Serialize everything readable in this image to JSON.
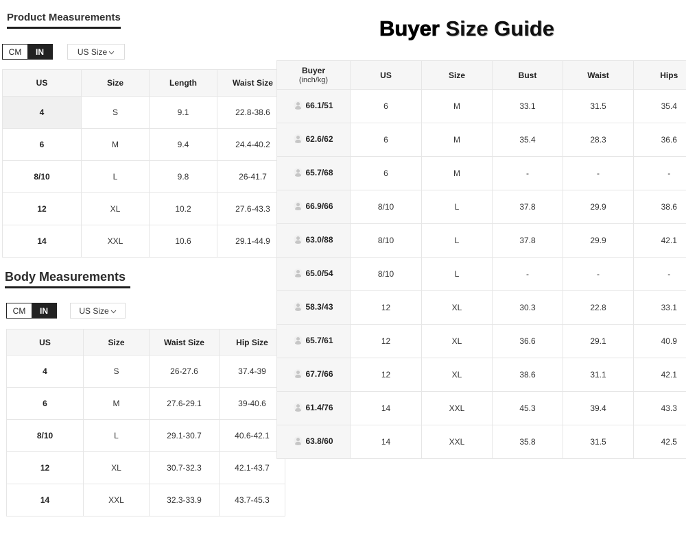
{
  "product_measurements": {
    "title": "Product Measurements",
    "unit_toggle": {
      "options": [
        "CM",
        "IN"
      ],
      "active_index": 1
    },
    "size_select": {
      "value": "US Size",
      "icon": "chevron-down-icon"
    },
    "columns": [
      "US",
      "Size",
      "Length",
      "Waist Size"
    ],
    "rows": [
      [
        "4",
        "S",
        "9.1",
        "22.8-38.6"
      ],
      [
        "6",
        "M",
        "9.4",
        "24.4-40.2"
      ],
      [
        "8/10",
        "L",
        "9.8",
        "26-41.7"
      ],
      [
        "12",
        "XL",
        "10.2",
        "27.6-43.3"
      ],
      [
        "14",
        "XXL",
        "10.6",
        "29.1-44.9"
      ]
    ]
  },
  "body_measurements": {
    "title": "Body Measurements",
    "unit_toggle": {
      "options": [
        "CM",
        "IN"
      ],
      "active_index": 1
    },
    "size_select": {
      "value": "US Size",
      "icon": "chevron-down-icon"
    },
    "columns": [
      "US",
      "Size",
      "Waist Size",
      "Hip Size"
    ],
    "rows": [
      [
        "4",
        "S",
        "26-27.6",
        "37.4-39"
      ],
      [
        "6",
        "M",
        "27.6-29.1",
        "39-40.6"
      ],
      [
        "8/10",
        "L",
        "29.1-30.7",
        "40.6-42.1"
      ],
      [
        "12",
        "XL",
        "30.7-32.3",
        "42.1-43.7"
      ],
      [
        "14",
        "XXL",
        "32.3-33.9",
        "43.7-45.3"
      ]
    ]
  },
  "buyer_size_guide": {
    "title": {
      "part1": "Buyer",
      "part2": "Size Guide"
    },
    "avatar_icon": "user-avatar-icon",
    "columns": [
      {
        "label": "Buyer",
        "sub": "(inch/kg)"
      },
      "US",
      "Size",
      "Bust",
      "Waist",
      "Hips"
    ],
    "rows": [
      [
        "66.1/51",
        "6",
        "M",
        "33.1",
        "31.5",
        "35.4"
      ],
      [
        "62.6/62",
        "6",
        "M",
        "35.4",
        "28.3",
        "36.6"
      ],
      [
        "65.7/68",
        "6",
        "M",
        "-",
        "-",
        "-"
      ],
      [
        "66.9/66",
        "8/10",
        "L",
        "37.8",
        "29.9",
        "38.6"
      ],
      [
        "63.0/88",
        "8/10",
        "L",
        "37.8",
        "29.9",
        "42.1"
      ],
      [
        "65.0/54",
        "8/10",
        "L",
        "-",
        "-",
        "-"
      ],
      [
        "58.3/43",
        "12",
        "XL",
        "30.3",
        "22.8",
        "33.1"
      ],
      [
        "65.7/61",
        "12",
        "XL",
        "36.6",
        "29.1",
        "40.9"
      ],
      [
        "67.7/66",
        "12",
        "XL",
        "38.6",
        "31.1",
        "42.1"
      ],
      [
        "61.4/76",
        "14",
        "XXL",
        "45.3",
        "39.4",
        "43.3"
      ],
      [
        "63.8/60",
        "14",
        "XXL",
        "35.8",
        "31.5",
        "42.5"
      ]
    ]
  },
  "colors": {
    "toggle_active": "#222222",
    "table_header_bg": "#f6f6f6",
    "table_border": "#e6e6e6"
  }
}
